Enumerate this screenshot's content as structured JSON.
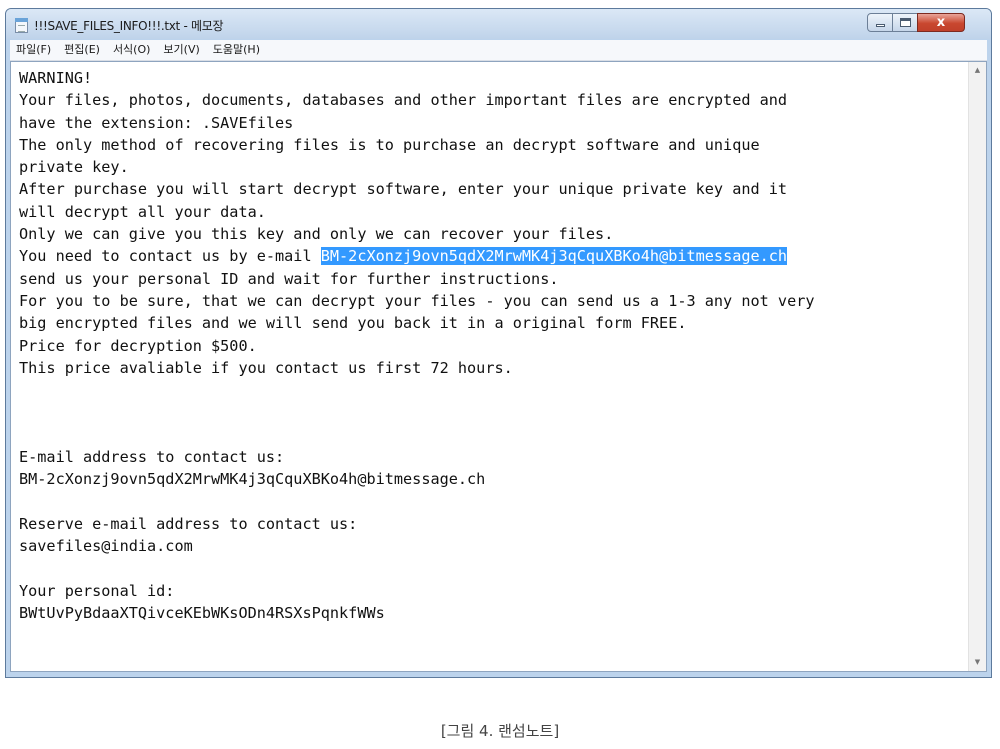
{
  "window": {
    "title": "!!!SAVE_FILES_INFO!!!.txt - 메모장",
    "close_glyph": "x"
  },
  "menu": [
    "파일(F)",
    "편집(E)",
    "서식(O)",
    "보기(V)",
    "도움말(H)"
  ],
  "document": {
    "line1": "WARNING!",
    "line2": "Your files, photos, documents, databases and other important files are encrypted and",
    "line3": "have the extension: .SAVEfiles",
    "line4": "The only method of recovering files is to purchase an decrypt software and unique",
    "line5": "private key.",
    "line6": "After purchase you will start decrypt software, enter your unique private key and it",
    "line7": "will decrypt all your data.",
    "line8": "Only we can give you this key and only we can recover your files.",
    "line9_prefix": "You need to contact us by e-mail ",
    "line9_selected": "BM-2cXonzj9ovn5qdX2MrwMK4j3qCquXBKo4h@bitmessage.ch",
    "line10": "send us your personal ID and wait for further instructions.",
    "line11": "For you to be sure, that we can decrypt your files - you can send us a 1-3 any not very",
    "line12": "big encrypted files and we will send you back it in a original form FREE.",
    "line13": "Price for decryption $500.",
    "line14": "This price avaliable if you contact us first 72 hours.",
    "email_label": "E-mail address to contact us:",
    "email_value": "BM-2cXonzj9ovn5qdX2MrwMK4j3qCquXBKo4h@bitmessage.ch",
    "reserve_label": "Reserve e-mail address to contact us:",
    "reserve_value": "savefiles@india.com",
    "id_label": "Your personal id:",
    "id_value": "BWtUvPyBdaaXTQivceKEbWKsODn4RSXsPqnkfWWs"
  },
  "caption": "[그림 4. 랜섬노트]",
  "colors": {
    "selection": "#3399ff",
    "close_button": "#c9472f"
  }
}
